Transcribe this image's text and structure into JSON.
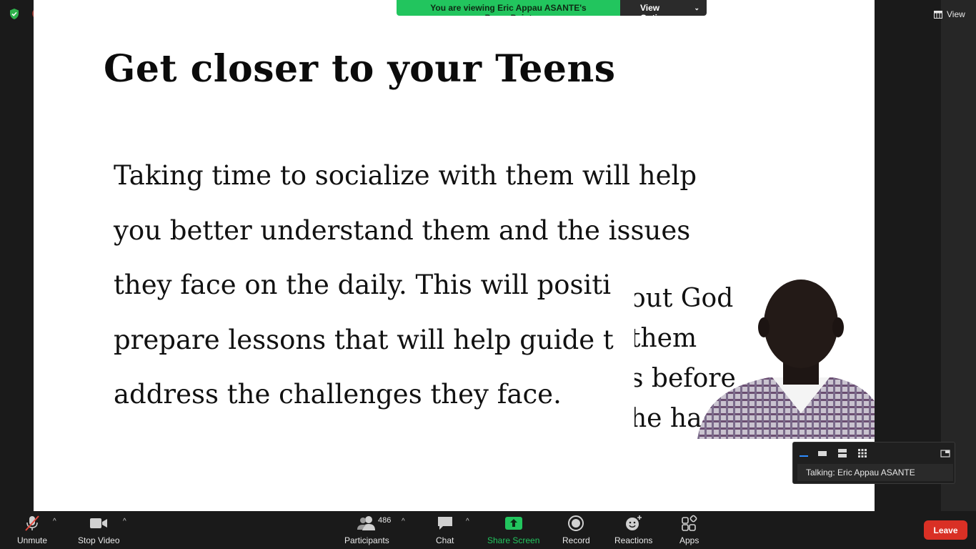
{
  "meeting": {
    "share_status": "You are viewing Eric Appau ASANTE's PowerPoint",
    "view_options_label": "View Options",
    "view_label": "View"
  },
  "slide": {
    "title": "Get closer to your Teens",
    "body_lines": [
      "Taking time to socialize with them will help",
      "you better understand them and the issues",
      "they face on the daily. This will positi",
      "prepare lessons that will help guide t",
      "address the challenges they face."
    ]
  },
  "speaker_video": {
    "background_text_lines": [
      "out God",
      "them",
      "s before",
      "he ha"
    ]
  },
  "speaker_panel": {
    "talking_label": "Talking: Eric Appau ASANTE"
  },
  "toolbar": {
    "unmute_label": "Unmute",
    "stop_video_label": "Stop Video",
    "participants_label": "Participants",
    "participants_count": "486",
    "chat_label": "Chat",
    "share_screen_label": "Share Screen",
    "record_label": "Record",
    "reactions_label": "Reactions",
    "apps_label": "Apps",
    "leave_label": "Leave"
  },
  "colors": {
    "share_green": "#22c55e",
    "leave_red": "#d93025",
    "toolbar_bg": "#1a1a1a",
    "panel_accent": "#2d8cff"
  }
}
